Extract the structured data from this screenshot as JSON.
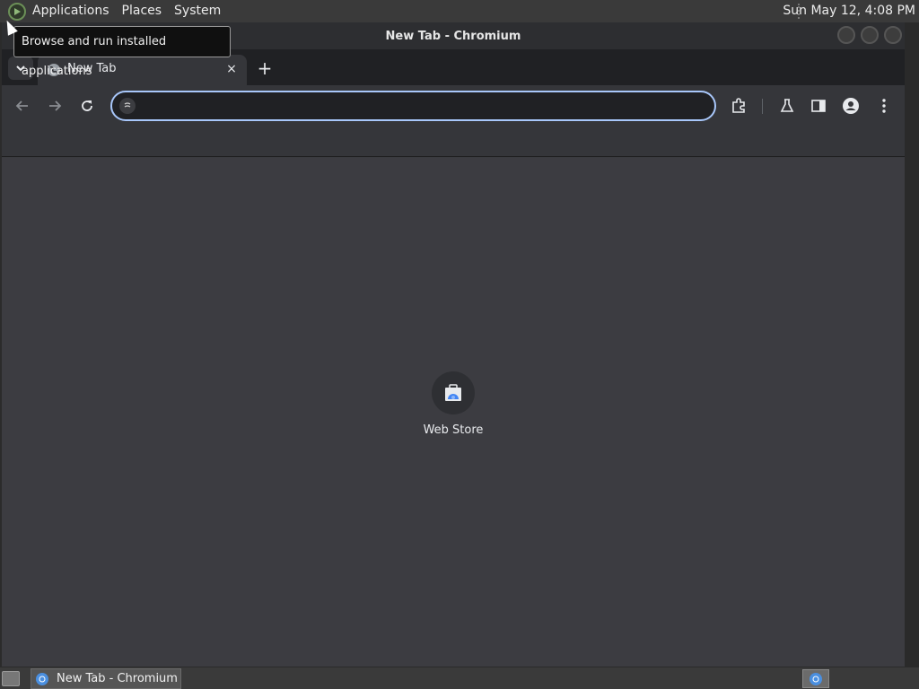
{
  "top_panel": {
    "menus": [
      "Applications",
      "Places",
      "System"
    ],
    "clock": "Sun May 12,  4:08 PM"
  },
  "tooltip": {
    "text": "Browse and run installed applications"
  },
  "window": {
    "title": "New Tab - Chromium",
    "tab": {
      "title": "New Tab",
      "close": "×"
    },
    "new_tab": "+",
    "omnibox": {
      "value": "",
      "placeholder": ""
    },
    "shortcuts": [
      {
        "label": "Web Store",
        "icon": "web-store-icon"
      }
    ]
  },
  "taskbar": {
    "tasks": [
      {
        "label": "New Tab - Chromium"
      }
    ]
  },
  "colors": {
    "omnibox_border": "#a8c7fa",
    "content_bg": "#3c3c41",
    "tab_bg": "#35363a"
  }
}
